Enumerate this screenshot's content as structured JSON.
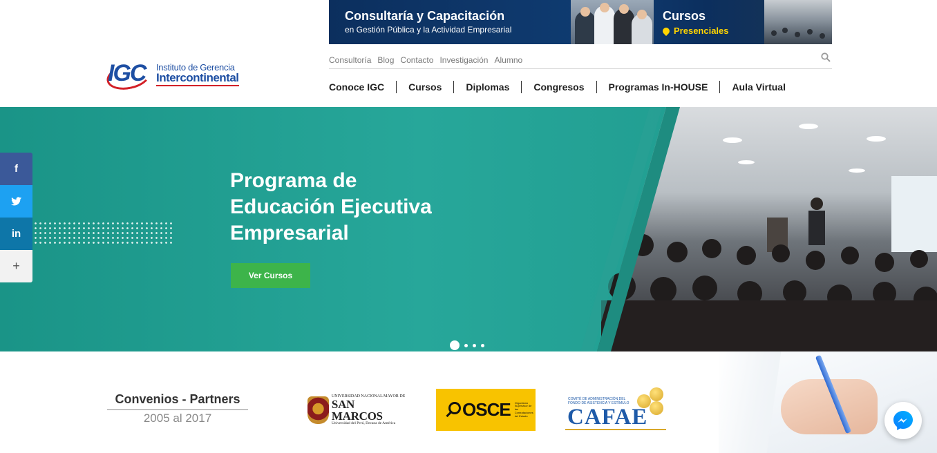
{
  "logo": {
    "mark": "IGC",
    "line1": "Instituto de Gerencia",
    "line2": "Intercontinental"
  },
  "banner": {
    "title": "Consultaría y Capacitación",
    "subtitle": "en Gestión Pública y la Actividad Empresarial",
    "cursos": "Cursos",
    "presenciales": "Presenciales"
  },
  "topnav": {
    "items": [
      {
        "label": "Consultoría"
      },
      {
        "label": "Blog"
      },
      {
        "label": "Contacto"
      },
      {
        "label": "Investigación"
      },
      {
        "label": "Alumno"
      }
    ],
    "search_icon": "search-icon"
  },
  "mainnav": {
    "items": [
      {
        "label": "Conoce IGC"
      },
      {
        "label": "Cursos"
      },
      {
        "label": "Diplomas"
      },
      {
        "label": "Congresos"
      },
      {
        "label": "Programas In-HOUSE"
      },
      {
        "label": "Aula Virtual"
      }
    ]
  },
  "hero": {
    "title_lines": [
      "Programa de",
      "Educación Ejecutiva",
      "Empresarial"
    ],
    "button": "Ver Cursos",
    "slides": 4,
    "active_slide": 1
  },
  "social": {
    "facebook": "f",
    "twitter": "twitter-icon",
    "linkedin": "in",
    "more": "+"
  },
  "partners": {
    "title": "Convenios - Partners",
    "years": "2005 al 2017",
    "sanmarcos": {
      "top": "UNIVERSIDAD NACIONAL MAYOR DE",
      "name": "SAN MARCOS",
      "bottom": "Universidad del Perú, Decana de América"
    },
    "osce": {
      "name": "OSCE",
      "small": "Organismo Supervisor de las Contrataciones del Estado"
    },
    "cafae": {
      "small": "COMITÉ DE ADMINISTRACIÓN DEL FONDO DE ASISTENCIA Y ESTÍMULO",
      "name": "CAFAE"
    }
  },
  "colors": {
    "brand_blue": "#1e4fa3",
    "brand_red": "#d32027",
    "hero_teal": "#1f9b8f",
    "button_green": "#3db44a",
    "facebook": "#3b5999",
    "twitter": "#1da1f2",
    "linkedin": "#0e76a8"
  }
}
